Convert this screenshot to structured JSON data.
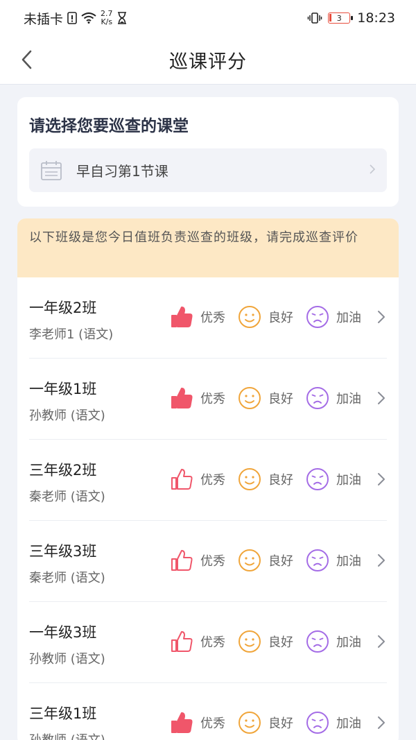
{
  "status_bar": {
    "carrier": "未插卡",
    "speed_value": "2.7",
    "speed_unit": "K/s",
    "battery": "3",
    "time": "18:23"
  },
  "nav": {
    "title": "巡课评分"
  },
  "select_card": {
    "title": "请选择您要巡查的课堂",
    "lesson": "早自习第1节课"
  },
  "notice": "以下班级是您今日值班负责巡查的班级，请完成巡查评价",
  "rating_labels": {
    "excellent": "优秀",
    "good": "良好",
    "cheer": "加油"
  },
  "colors": {
    "excellent": "#f0566a",
    "good": "#f0a53a",
    "cheer": "#a46ce6",
    "notice_bg": "#fde8c5"
  },
  "classes": [
    {
      "name": "一年级2班",
      "teacher": "李老师1 (语文)",
      "excellent_selected": true
    },
    {
      "name": "一年级1班",
      "teacher": "孙教师 (语文)",
      "excellent_selected": true
    },
    {
      "name": "三年级2班",
      "teacher": "秦老师 (语文)",
      "excellent_selected": false
    },
    {
      "name": "三年级3班",
      "teacher": "秦老师 (语文)",
      "excellent_selected": false
    },
    {
      "name": "一年级3班",
      "teacher": "孙教师 (语文)",
      "excellent_selected": false
    },
    {
      "name": "三年级1班",
      "teacher": "孙教师 (语文)",
      "excellent_selected": true
    }
  ]
}
